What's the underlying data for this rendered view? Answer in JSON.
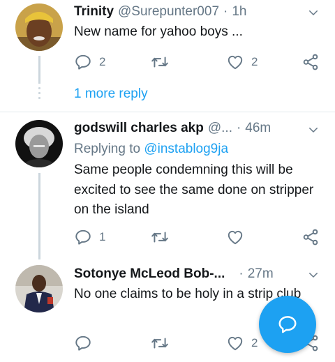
{
  "tweets": [
    {
      "name": "Trinity",
      "handle": "@Surepunter007",
      "separator": "·",
      "time": "1h",
      "text": "New name for yahoo boys ...",
      "replies": "2",
      "retweets": "",
      "likes": "2"
    },
    {
      "name": "godswill charles akp",
      "handle": "@...",
      "separator": "·",
      "time": "46m",
      "replying_label": "Replying to",
      "replying_to": "@instablog9ja",
      "text": "Same people condemning this will be excited to see the same done on stripper on the island",
      "replies": "1",
      "retweets": "",
      "likes": ""
    },
    {
      "name": "Sotonye McLeod Bob-...",
      "handle": "",
      "separator": "·",
      "time": "27m",
      "text": "No one claims to be holy in a strip club",
      "replies": "",
      "retweets": "",
      "likes": "2"
    }
  ],
  "thread": {
    "more_reply_label": "1 more reply"
  },
  "colors": {
    "accent": "#1da1f2",
    "muted": "#657786",
    "divider": "#e1e8ed"
  },
  "icons": [
    "reply-icon",
    "retweet-icon",
    "like-icon",
    "share-icon",
    "chevron-down-icon",
    "compose-reply-icon"
  ]
}
